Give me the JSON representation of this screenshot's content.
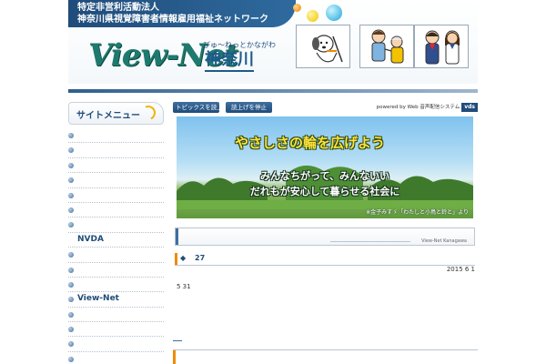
{
  "header": {
    "org_line1": "特定非営利活動法人",
    "org_line2": "神奈川県視覚障害者情報雇用福祉ネットワーク",
    "logo_main": "View-Net",
    "logo_ruby": "びゅ～ねっとかながわ",
    "logo_city": "神奈川"
  },
  "sidebar": {
    "title": "サイトメニュー",
    "items": [
      {
        "label": ""
      },
      {
        "label": ""
      },
      {
        "label": ""
      },
      {
        "label": ""
      },
      {
        "label": ""
      },
      {
        "label": ""
      },
      {
        "label": ""
      },
      {
        "label": "NVDA"
      },
      {
        "label": ""
      },
      {
        "label": ""
      },
      {
        "label": ""
      },
      {
        "label": "View-Net"
      },
      {
        "label": ""
      },
      {
        "label": ""
      },
      {
        "label": ""
      },
      {
        "label": ""
      },
      {
        "label": ""
      }
    ]
  },
  "topbar": {
    "read_topics": "トピックスを読上げ",
    "stop_reading": "読上げを停止",
    "powered_by": "powered by Web 音声配信システム",
    "powered_brand": "vds"
  },
  "banner": {
    "headline": "やさしさの輪を広げよう",
    "line1": "みんなちがって、みんないい",
    "line2": "だれもが安心して暮らせる社会に",
    "credit": "※金子みすゞ「わたしと小鳥と鈴と」より"
  },
  "box1": {
    "label": "View-Net Kanagawa"
  },
  "news": {
    "title": "27",
    "date": "2015 6 1",
    "body": "5 31"
  },
  "colors": {
    "navy": "#1f4c7a",
    "accent_orange": "#f08a00",
    "logo_green": "#1e7a6e"
  }
}
